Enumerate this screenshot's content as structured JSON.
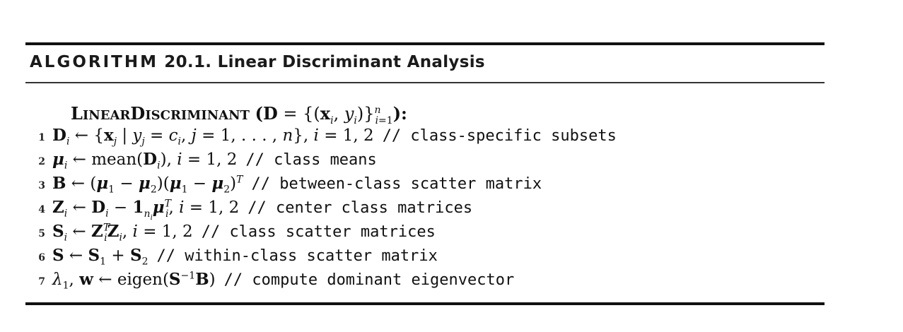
{
  "algorithm": {
    "label": "ALGORITHM",
    "number": "20.1.",
    "title": "Linear Discriminant Analysis",
    "signature": {
      "name_big_1": "L",
      "name_small_1": "INEAR",
      "name_big_2": "D",
      "name_small_2": "ISCRIMINANT",
      "args": "(D = {(xi, yi)}i=1n):"
    },
    "lines": [
      {
        "no": "1",
        "comment": "// class-specific subsets"
      },
      {
        "no": "2",
        "comment": "// class means"
      },
      {
        "no": "3",
        "comment": "// between-class scatter matrix"
      },
      {
        "no": "4",
        "comment": "// center class matrices"
      },
      {
        "no": "5",
        "comment": "// class scatter matrices"
      },
      {
        "no": "6",
        "comment": "// within-class scatter matrix"
      },
      {
        "no": "7",
        "comment": "// compute dominant eigenvector"
      }
    ]
  }
}
